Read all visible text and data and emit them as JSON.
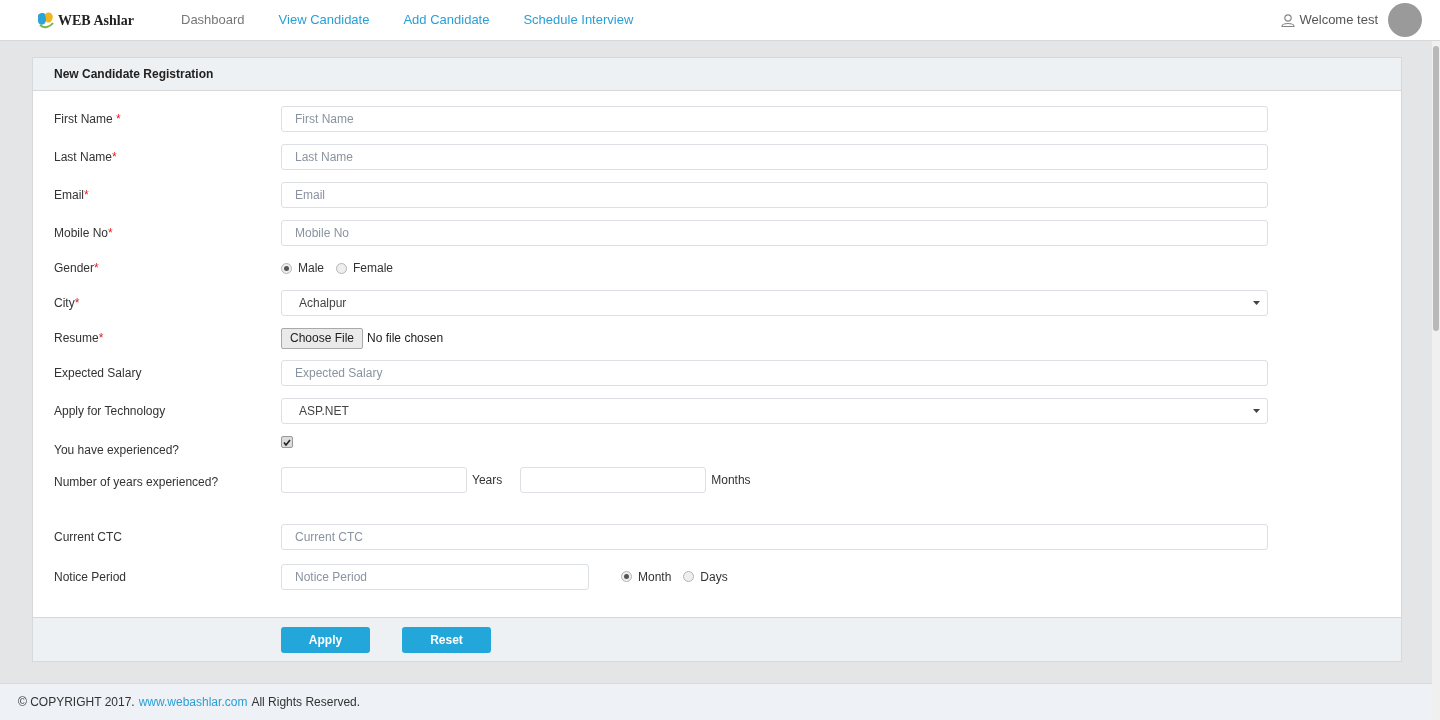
{
  "header": {
    "logo": "WEB Ashlar",
    "nav": [
      {
        "label": "Dashboard",
        "selected": true
      },
      {
        "label": "View Candidate",
        "selected": false
      },
      {
        "label": "Add Candidate",
        "selected": false
      },
      {
        "label": "Schedule Interview",
        "selected": false
      }
    ],
    "welcome": "Welcome test"
  },
  "panel": {
    "title": "New Candidate Registration",
    "fields": [
      {
        "kind": "text",
        "label": "First Name",
        "mark": " *",
        "placeholder": "First Name"
      },
      {
        "kind": "text",
        "label": "Last Name",
        "mark": "*",
        "placeholder": "Last Name"
      },
      {
        "kind": "text",
        "label": "Email",
        "mark": "*",
        "placeholder": "Email"
      },
      {
        "kind": "text",
        "label": "Mobile No",
        "mark": "*",
        "placeholder": "Mobile No"
      },
      {
        "kind": "radio",
        "label": "Gender",
        "mark": "*",
        "options": [
          {
            "label": "Male",
            "selected": true
          },
          {
            "label": "Female",
            "selected": false
          }
        ]
      },
      {
        "kind": "select",
        "label": "City",
        "mark": "*",
        "value": "Achalpur"
      },
      {
        "kind": "file",
        "label": "Resume",
        "mark": "*",
        "button": "Choose File",
        "status": "No file chosen"
      },
      {
        "kind": "text",
        "label": "Expected Salary",
        "placeholder": "Expected Salary"
      },
      {
        "kind": "select",
        "label": "Apply for Technology",
        "value": "ASP.NET"
      },
      {
        "kind": "checkbox",
        "label": "You have experienced?",
        "checked": true
      },
      {
        "kind": "duration",
        "label": "Number of years experienced?",
        "units": [
          "Years",
          "Months"
        ]
      },
      {
        "kind": "text",
        "label": "Current CTC",
        "placeholder": "Current CTC"
      },
      {
        "kind": "notice",
        "label": "Notice Period",
        "placeholder": "Notice Period",
        "options": [
          {
            "label": "Month",
            "selected": true
          },
          {
            "label": "Days",
            "selected": false
          }
        ]
      }
    ],
    "buttons": [
      "Apply",
      "Reset"
    ]
  },
  "footer": {
    "before": "© COPYRIGHT 2017.",
    "link": "www.webashlar.com",
    "after": "All Rights Reserved."
  }
}
